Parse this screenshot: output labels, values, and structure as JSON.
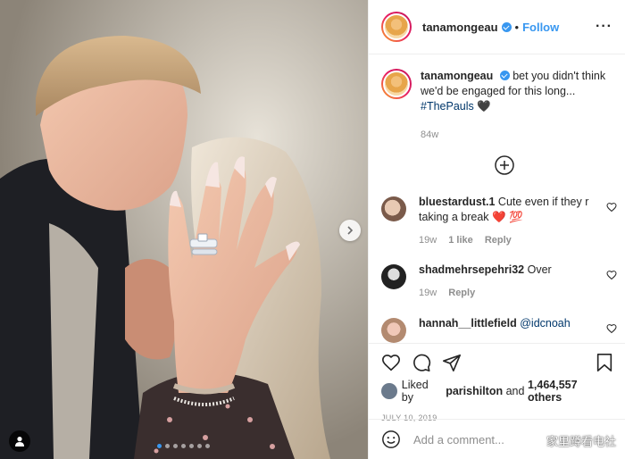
{
  "header": {
    "username": "tanamongeau",
    "separator": "•",
    "follow_label": "Follow",
    "more_label": "···"
  },
  "caption": {
    "username": "tanamongeau",
    "text": "bet you didn't think we'd be engaged for this long...",
    "hashtag": "#ThePauls",
    "emoji": "🖤",
    "age": "84w"
  },
  "comments": [
    {
      "username": "bluestardust.1",
      "text": "Cute even if they r taking a break",
      "emoji": "❤️ 💯",
      "age": "19w",
      "likes": "1 like",
      "reply": "Reply"
    },
    {
      "username": "shadmehrsepehri32",
      "text": "Over",
      "age": "19w",
      "reply": "Reply"
    },
    {
      "username": "hannah__littlefield",
      "mention": "@idcnoah"
    }
  ],
  "likes": {
    "prefix": "Liked by",
    "user": "parishilton",
    "and": "and",
    "count": "1,464,557 others"
  },
  "date": "JULY 10, 2019",
  "add_comment": {
    "placeholder": "Add a comment..."
  },
  "watermark": "家里蹲看电社",
  "carousel": {
    "slides": 7,
    "active_index": 0
  },
  "colors": {
    "accent": "#3897f0",
    "text": "#262626",
    "muted": "#8e8e8e",
    "heart_red": "#ed4956"
  }
}
